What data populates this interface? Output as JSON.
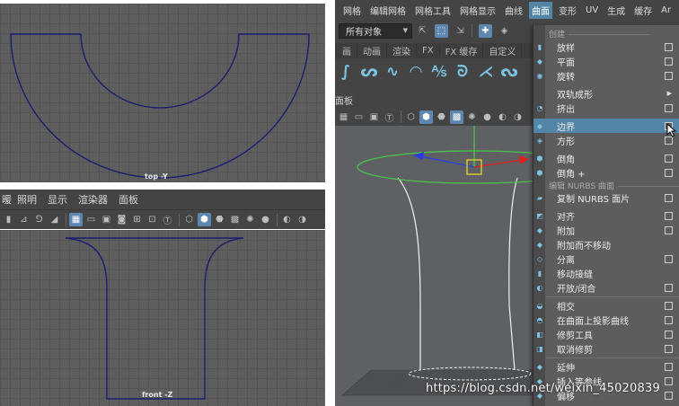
{
  "viewports": {
    "top_label": "top -Y",
    "front_label": "front -Z"
  },
  "left_panel": {
    "menu_items": [
      "照明",
      "显示",
      "渲染器",
      "面板"
    ],
    "menu_partial": "暖"
  },
  "right_panel": {
    "menubar": [
      "网格",
      "编辑网格",
      "网格工具",
      "网格显示",
      "曲线",
      "曲面",
      "变形",
      "UV",
      "生成",
      "缓存",
      "Ar"
    ],
    "active_menu": "曲面",
    "object_filter": "所有对象",
    "shelf_tabs": [
      "画",
      "动画",
      "渲染",
      "FX",
      "FX 缓存",
      "自定义"
    ],
    "panel_label": "面板"
  },
  "surface_menu": {
    "section_create": "创建",
    "section_edit": "编辑 NURBS 曲面",
    "items_create": [
      {
        "label": "放样",
        "icon": "loft-icon",
        "has_option_box": true
      },
      {
        "label": "平面",
        "icon": "planar-icon",
        "has_option_box": true
      },
      {
        "label": "旋转",
        "icon": "revolve-icon",
        "has_option_box": true
      },
      {
        "label": "双轨成形",
        "icon": "birail-icon",
        "has_submenu": true
      },
      {
        "label": "挤出",
        "icon": "extrude-icon",
        "has_option_box": true
      },
      {
        "label": "边界",
        "icon": "boundary-icon",
        "has_option_box": true,
        "highlighted": true
      },
      {
        "label": "方形",
        "icon": "square-icon",
        "has_option_box": true
      },
      {
        "label": "倒角",
        "icon": "bevel-icon",
        "has_option_box": true
      },
      {
        "label": "倒角 +",
        "icon": "bevel-plus-icon",
        "has_option_box": true
      }
    ],
    "items_edit": [
      {
        "label": "复制 NURBS 面片",
        "icon": "duplicate-patch-icon",
        "has_option_box": true
      },
      {
        "label": "对齐",
        "icon": "align-icon",
        "has_option_box": true
      },
      {
        "label": "附加",
        "icon": "attach-icon",
        "has_option_box": true
      },
      {
        "label": "附加而不移动",
        "icon": "attach-no-move-icon",
        "has_option_box": false
      },
      {
        "label": "分离",
        "icon": "detach-icon",
        "has_option_box": true
      },
      {
        "label": "移动接缝",
        "icon": "move-seam-icon",
        "has_option_box": false
      },
      {
        "label": "开放/闭合",
        "icon": "open-close-icon",
        "has_option_box": true
      },
      {
        "label": "相交",
        "icon": "intersect-icon",
        "has_option_box": true
      },
      {
        "label": "在曲面上投影曲线",
        "icon": "project-curve-icon",
        "has_option_box": true
      },
      {
        "label": "修剪工具",
        "icon": "trim-tool-icon",
        "has_option_box": true
      },
      {
        "label": "取消修剪",
        "icon": "untrim-icon",
        "has_option_box": true
      },
      {
        "label": "延伸",
        "icon": "extend-icon",
        "has_option_box": true
      },
      {
        "label": "插入等参线",
        "icon": "insert-isoparm-icon",
        "has_option_box": true
      },
      {
        "label": "偏移",
        "icon": "offset-icon",
        "has_option_box": true
      }
    ]
  },
  "watermark": "https://blog.csdn.net/weixin_45020839",
  "colors": {
    "curve": "#1a1f6e",
    "menu_highlight": "#5285a6",
    "manip_green": "#4cc24c",
    "manip_red": "#e02020",
    "manip_blue": "#2b3fe0",
    "manip_yellow": "#f0e020"
  }
}
